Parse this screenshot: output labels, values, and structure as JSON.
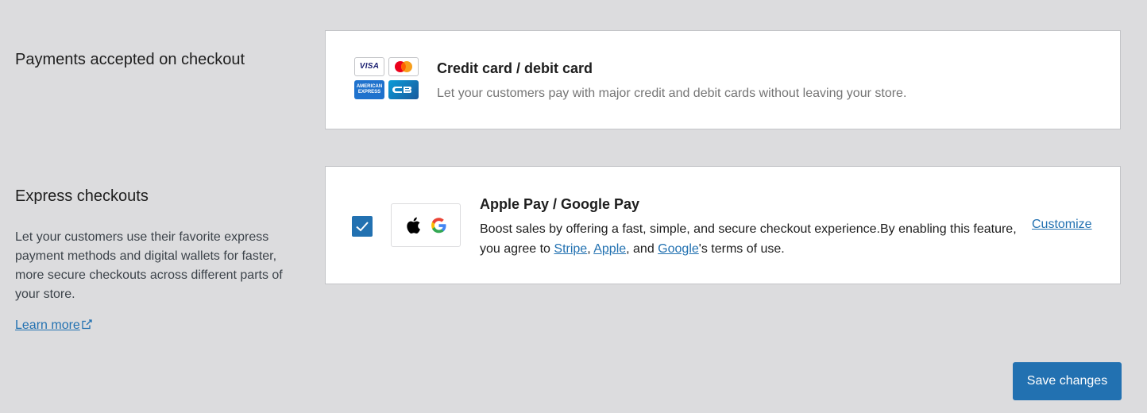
{
  "payments_section": {
    "title": "Payments accepted on checkout"
  },
  "credit_card": {
    "logos": [
      "visa",
      "mastercard",
      "american-express",
      "cartes-bancaires"
    ],
    "visa_text": "VISA",
    "amex_text": "AMERICAN EXPRESS",
    "title": "Credit card / debit card",
    "description": "Let your customers pay with major credit and debit cards without leaving your store."
  },
  "express_section": {
    "title": "Express checkouts",
    "description": "Let your customers use their favorite express payment methods and digital wallets for faster, more secure checkouts across different parts of your store.",
    "learn_more": "Learn more"
  },
  "express_method": {
    "checked": true,
    "title": "Apple Pay / Google Pay",
    "description_start": "Boost sales by offering a fast, simple, and secure checkout experience.By enabling this feature, you agree to ",
    "link_stripe": "Stripe",
    "sep1": ", ",
    "link_apple": "Apple",
    "sep2": ", and ",
    "link_google": "Google",
    "description_end": "'s terms of use.",
    "customize": "Customize"
  },
  "actions": {
    "save_label": "Save changes"
  },
  "colors": {
    "accent": "#2271b1",
    "background": "#dcdcde"
  }
}
